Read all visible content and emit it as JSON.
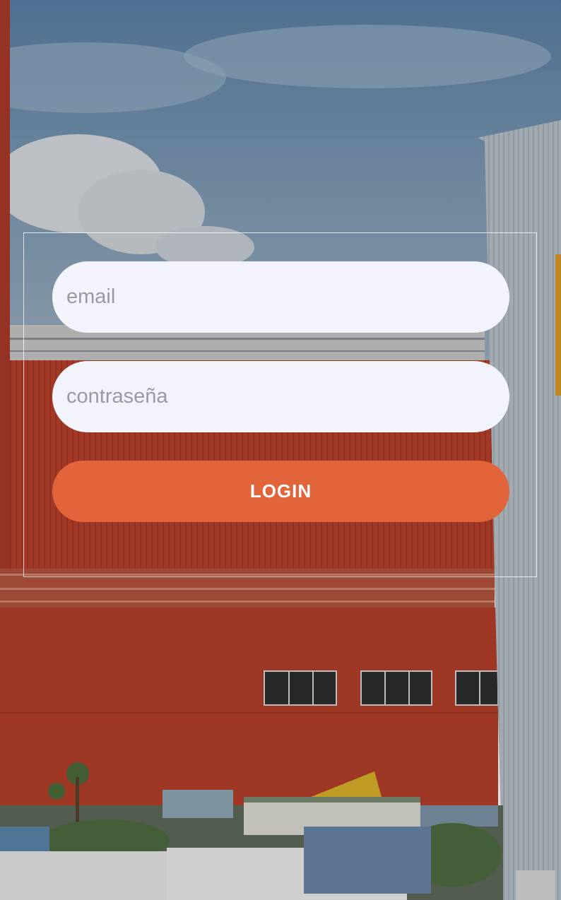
{
  "login_form": {
    "email_placeholder": "email",
    "password_placeholder": "contraseña",
    "login_label": "LOGIN"
  },
  "colors": {
    "accent": "#e1643a",
    "input_background": "#f3f4fb",
    "placeholder": "#9a9a9e",
    "building_red": "#b8412c"
  }
}
